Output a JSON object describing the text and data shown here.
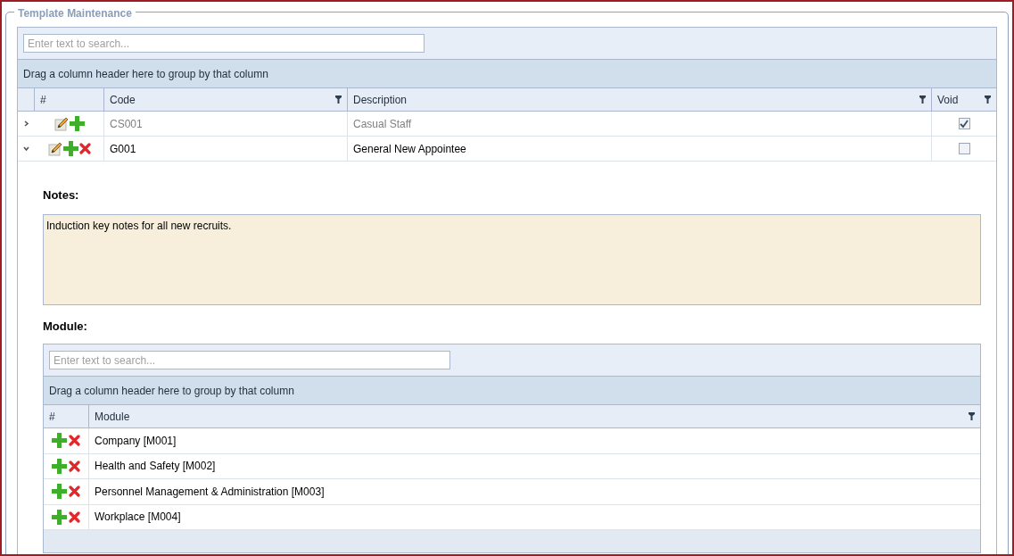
{
  "fieldset": {
    "legend": "Template Maintenance"
  },
  "grid": {
    "search": {
      "placeholder": "Enter text to search..."
    },
    "group_panel": "Drag a column header here to group by that column",
    "columns": [
      {
        "label": "#",
        "filter": false
      },
      {
        "label": "Code",
        "filter": true
      },
      {
        "label": "Description",
        "filter": true
      },
      {
        "label": "Void",
        "filter": true
      }
    ],
    "rows": [
      {
        "expanded": false,
        "code": "CS001",
        "description": "Casual Staff",
        "void": true,
        "deletable": false
      },
      {
        "expanded": true,
        "code": "G001",
        "description": "General New Appointee",
        "void": false,
        "deletable": true
      }
    ]
  },
  "detail": {
    "notes_label": "Notes:",
    "notes": "Induction key notes for all new recruits.",
    "module_label": "Module:",
    "module_grid": {
      "search": {
        "placeholder": "Enter text to search..."
      },
      "group_panel": "Drag a column header here to group by that column",
      "columns": [
        {
          "label": "#",
          "filter": false
        },
        {
          "label": "Module",
          "filter": true
        }
      ],
      "rows": [
        {
          "module": "Company [M001]"
        },
        {
          "module": "Health and Safety [M002]"
        },
        {
          "module": "Personnel Management & Administration [M003]"
        },
        {
          "module": "Workplace [M004]"
        }
      ]
    }
  }
}
